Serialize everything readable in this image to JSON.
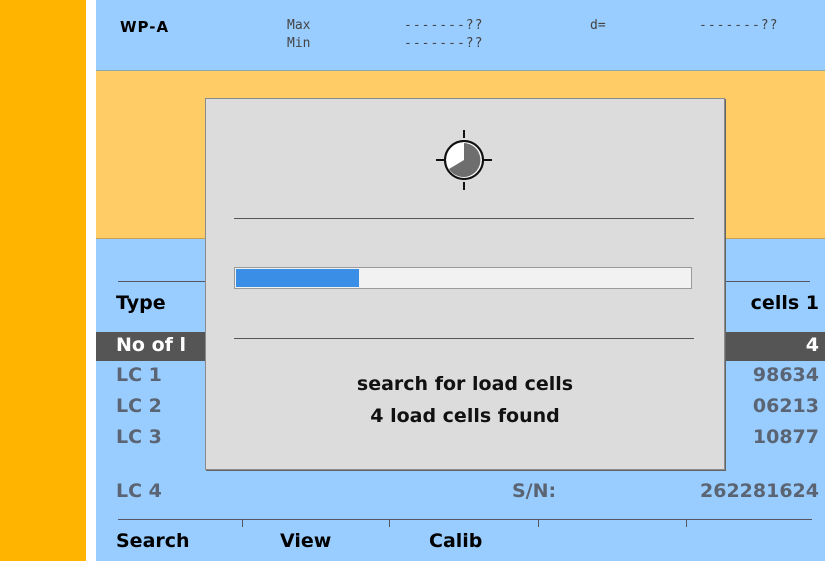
{
  "header": {
    "title": "WP-A",
    "max_label": "Max",
    "max_value": "-------??",
    "min_label": "Min",
    "min_value": "-------??",
    "d_label": "d=",
    "d_value": "-------??"
  },
  "list": {
    "type_label": "Type",
    "type_value": "cells 1",
    "count_label": "No of l",
    "count_value": "4",
    "rows": [
      {
        "label": "LC 1",
        "serial_label": "",
        "value": "98634"
      },
      {
        "label": "LC 2",
        "serial_label": "",
        "value": "06213"
      },
      {
        "label": "LC 3",
        "serial_label": "",
        "value": "10877"
      },
      {
        "label": "LC 4",
        "serial_label": "S/N:",
        "value": "262281624"
      }
    ]
  },
  "softkeys": [
    "Search",
    "View",
    "Calib",
    "",
    ""
  ],
  "dialog": {
    "icon": "clock-icon",
    "progress_fraction": 0.27,
    "line1": "search for load cells",
    "line2": "4 load cells found"
  },
  "colors": {
    "left_bar": "#ffb400",
    "screen_bg": "#99ccff",
    "band": "#ffcc66",
    "progress": "#3a8ee6",
    "selected_row": "#555555"
  }
}
